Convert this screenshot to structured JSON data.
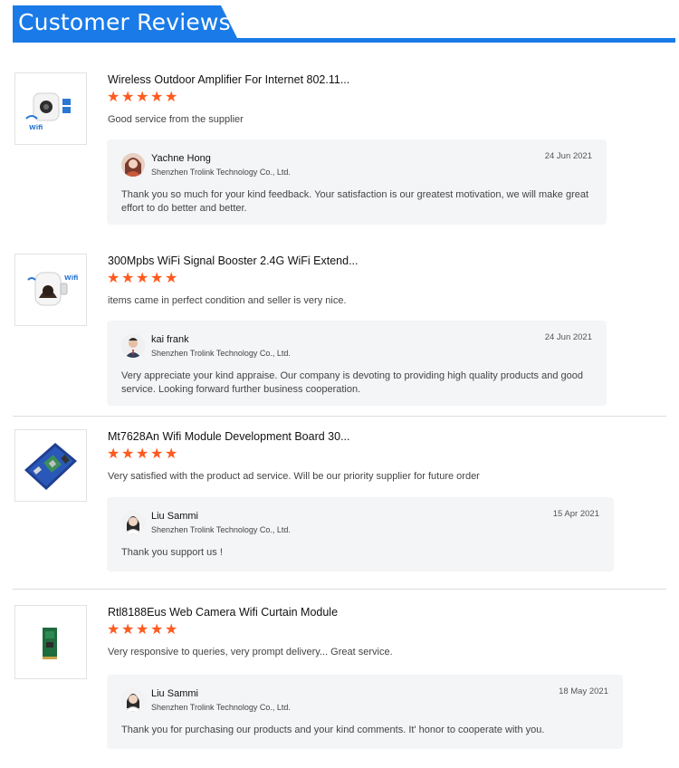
{
  "header": {
    "title": "Customer Reviews"
  },
  "colors": {
    "brand_blue": "#1a7be8",
    "star_orange": "#ff5a1f",
    "reply_bg": "#f4f5f7"
  },
  "reviews": [
    {
      "product_title": "Wireless Outdoor Amplifier For Internet 802.11...",
      "rating": 5,
      "comment": "Good service from the supplier",
      "thumbnail_icon": "wifi-repeater-image",
      "reply": {
        "name": "Yachne Hong",
        "company": "Shenzhen Trolink Technology Co., Ltd.",
        "date": "24 Jun 2021",
        "lines": [
          "Thank you so much for your kind feedback. Your satisfaction is our greatest motivation, we will make great",
          "effort to do better and better."
        ]
      }
    },
    {
      "product_title": "300Mpbs WiFi Signal Booster 2.4G WiFi Extend...",
      "rating": 5,
      "comment": "items came in perfect condition and seller is very nice.",
      "thumbnail_icon": "wifi-booster-image",
      "reply": {
        "name": "kai frank",
        "company": "Shenzhen Trolink Technology Co., Ltd.",
        "date": "24 Jun 2021",
        "lines": [
          "Very appreciate your kind appraise. Our company is devoting to providing high quality products and  good",
          "service.  Looking forward further business cooperation."
        ]
      }
    },
    {
      "product_title": "Mt7628An Wifi Module Development Board 30...",
      "rating": 5,
      "comment": "Very satisfied with the product ad service. Will be our priority supplier for future order",
      "thumbnail_icon": "development-board-image",
      "reply": {
        "name": "Liu Sammi",
        "company": "Shenzhen Trolink Technology Co., Ltd.",
        "date": "15 Apr 2021",
        "lines": [
          "Thank you support us !"
        ]
      }
    },
    {
      "product_title": "Rtl8188Eus Web Camera Wifi Curtain Module",
      "rating": 5,
      "comment": "Very responsive to queries, very prompt delivery... Great service.",
      "thumbnail_icon": "wifi-module-image",
      "reply": {
        "name": "Liu Sammi",
        "company": "Shenzhen Trolink Technology Co., Ltd.",
        "date": "18 May 2021",
        "lines": [
          "Thank you for purchasing our products and your kind comments. It' honor to cooperate with you."
        ]
      }
    }
  ]
}
